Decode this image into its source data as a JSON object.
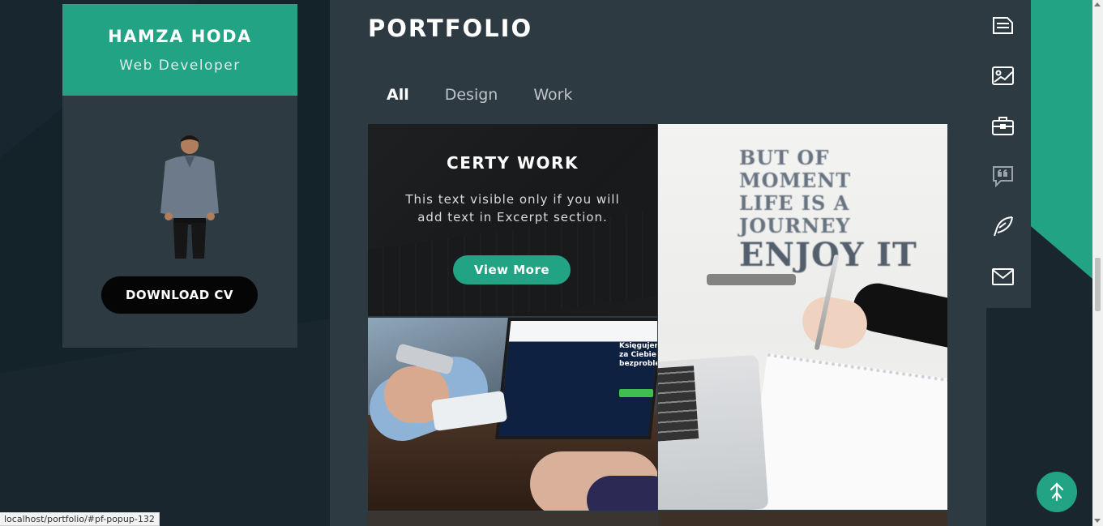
{
  "profile": {
    "name": "HAMZA HODA",
    "role": "Web Developer",
    "download_label": "DOWNLOAD CV"
  },
  "portfolio": {
    "title": "PORTFOLIO",
    "filters": [
      "All",
      "Design",
      "Work"
    ],
    "active_filter": "All",
    "featured_item": {
      "title": "CERTY WORK",
      "excerpt": "This text visible only if you will add text in Excerpt section.",
      "button_label": "View More"
    },
    "poster_text": [
      "BUT OF MOMENT",
      "LIFE IS A JOURNEY",
      "ENJOY IT"
    ],
    "screen_text": "Księgujemy za Ciebie bezproblemowo"
  },
  "right_nav": {
    "icons": [
      "resume-icon",
      "portfolio-image-icon",
      "briefcase-icon",
      "quote-icon",
      "feather-icon",
      "envelope-icon"
    ]
  },
  "status_bar": {
    "url": "localhost/portfolio/#pf-popup-132"
  },
  "colors": {
    "accent": "#22a384",
    "panel": "#2d3a42",
    "background": "#1a262d"
  }
}
